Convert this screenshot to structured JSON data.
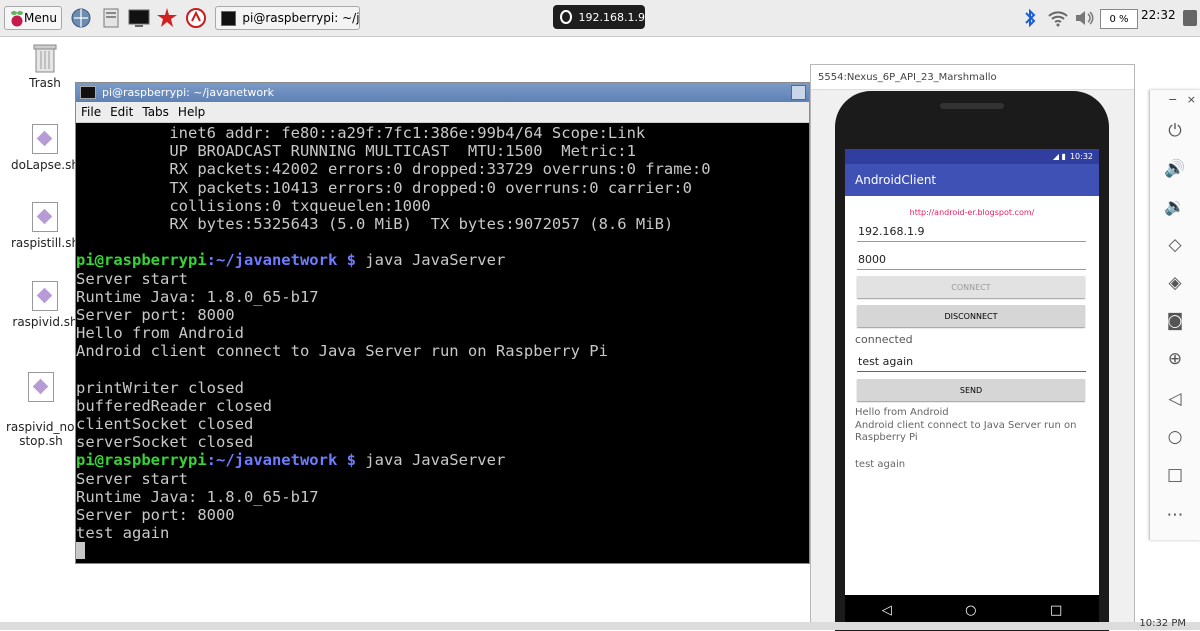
{
  "taskbar": {
    "menu_label": "Menu",
    "task_title": "pi@raspberrypi: ~/java",
    "ip_address": "192.168.1.9",
    "cpu_usage": "0 %",
    "clock": "22:32"
  },
  "desktop": {
    "icons": [
      {
        "label": "Trash"
      },
      {
        "label": "doLapse.sh"
      },
      {
        "label": "raspistill.sh"
      },
      {
        "label": "raspivid.sh"
      },
      {
        "label": "raspivid_non\nstop.sh"
      }
    ]
  },
  "terminal": {
    "title": "pi@raspberrypi: ~/javanetwork",
    "menu": [
      "File",
      "Edit",
      "Tabs",
      "Help"
    ],
    "lines": [
      {
        "type": "out",
        "text": "          inet6 addr: fe80::a29f:7fc1:386e:99b4/64 Scope:Link"
      },
      {
        "type": "out",
        "text": "          UP BROADCAST RUNNING MULTICAST  MTU:1500  Metric:1"
      },
      {
        "type": "out",
        "text": "          RX packets:42002 errors:0 dropped:33729 overruns:0 frame:0"
      },
      {
        "type": "out",
        "text": "          TX packets:10413 errors:0 dropped:0 overruns:0 carrier:0"
      },
      {
        "type": "out",
        "text": "          collisions:0 txqueuelen:1000"
      },
      {
        "type": "out",
        "text": "          RX bytes:5325643 (5.0 MiB)  TX bytes:9072057 (8.6 MiB)"
      },
      {
        "type": "out",
        "text": ""
      },
      {
        "type": "prompt",
        "user": "pi@raspberrypi",
        "path": ":~/javanetwork $",
        "cmd": " java JavaServer"
      },
      {
        "type": "out",
        "text": "Server start"
      },
      {
        "type": "out",
        "text": "Runtime Java: 1.8.0_65-b17"
      },
      {
        "type": "out",
        "text": "Server port: 8000"
      },
      {
        "type": "out",
        "text": "Hello from Android"
      },
      {
        "type": "out",
        "text": "Android client connect to Java Server run on Raspberry Pi"
      },
      {
        "type": "out",
        "text": ""
      },
      {
        "type": "out",
        "text": "printWriter closed"
      },
      {
        "type": "out",
        "text": "bufferedReader closed"
      },
      {
        "type": "out",
        "text": "clientSocket closed"
      },
      {
        "type": "out",
        "text": "serverSocket closed"
      },
      {
        "type": "prompt",
        "user": "pi@raspberrypi",
        "path": ":~/javanetwork $",
        "cmd": " java JavaServer"
      },
      {
        "type": "out",
        "text": "Server start"
      },
      {
        "type": "out",
        "text": "Runtime Java: 1.8.0_65-b17"
      },
      {
        "type": "out",
        "text": "Server port: 8000"
      },
      {
        "type": "out",
        "text": "test again"
      },
      {
        "type": "cursor",
        "text": ""
      }
    ]
  },
  "emulator": {
    "title": "5554:Nexus_6P_API_23_Marshmallo",
    "status_time": "10:32",
    "app_title": "AndroidClient",
    "link": "http://android-er.blogspot.com/",
    "ip_value": "192.168.1.9",
    "port_value": "8000",
    "connect_label": "CONNECT",
    "disconnect_label": "DISCONNECT",
    "status_text": "connected",
    "message_value": "test again",
    "send_label": "SEND",
    "received_1": "Hello from Android",
    "received_2": "Android client connect to Java Server run on Raspberry Pi",
    "received_3": "test again"
  },
  "bottom_clock": "10:32 PM"
}
